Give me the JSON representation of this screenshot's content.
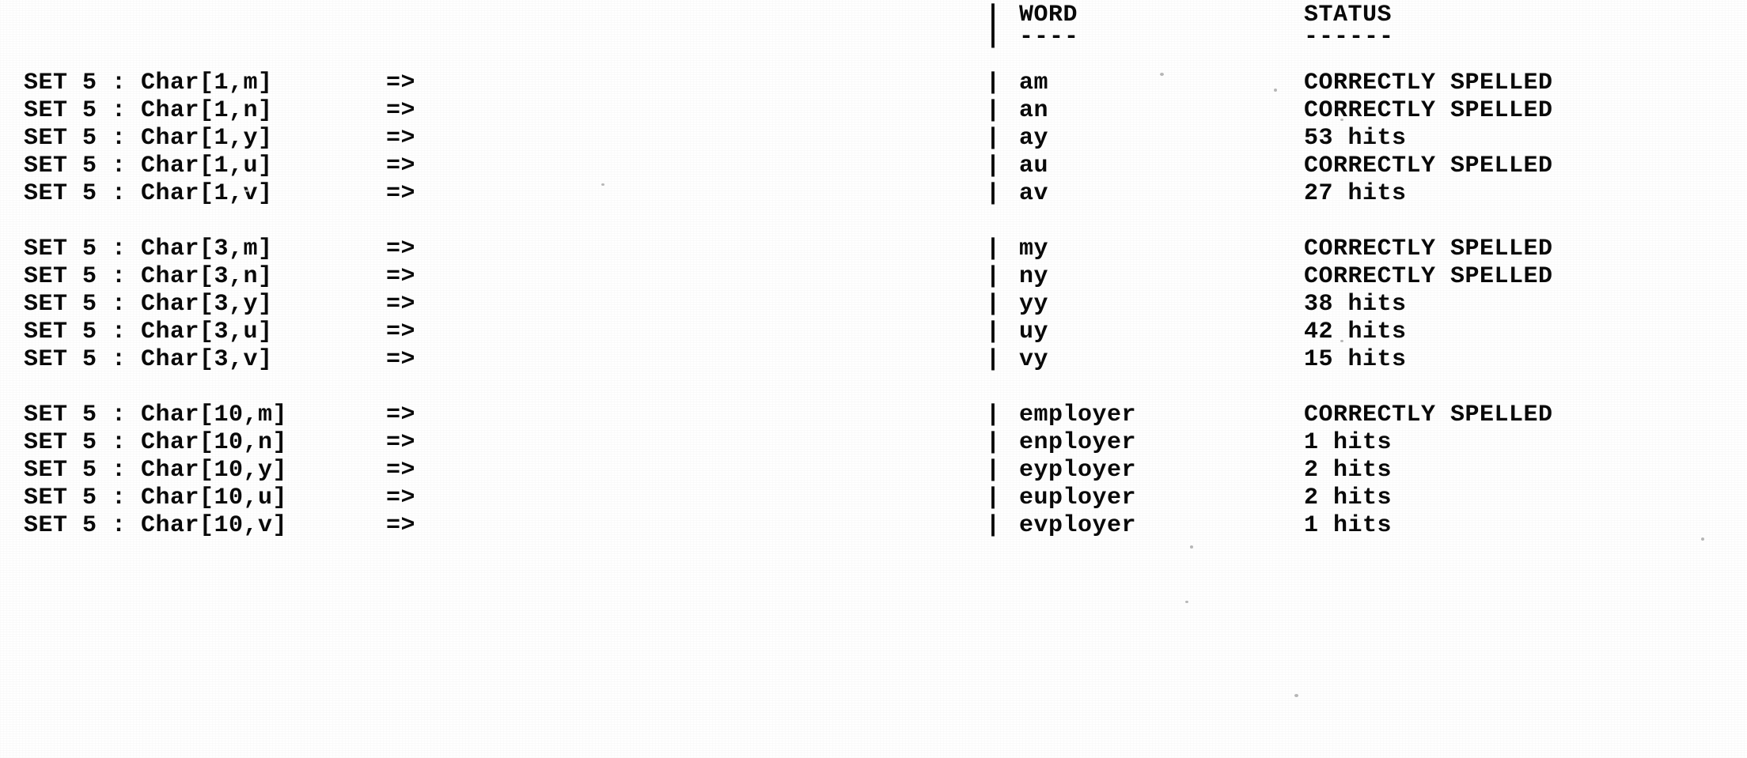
{
  "document": {
    "kind": "program-output-listing",
    "background_color": "#ffffff",
    "text_color": "#0a0a0a",
    "separator_char": "|",
    "arrow_symbol": "=>"
  },
  "table": {
    "headers": {
      "word_label": "WORD",
      "status_label": "STATUS",
      "word_underline": "----",
      "status_underline": "------"
    }
  },
  "blocks": [
    {
      "name": "position-1",
      "rows": [
        {
          "left": "SET 5 : Char[1,m]",
          "arrow": "=>",
          "pipe": "|",
          "word": "am",
          "status": "CORRECTLY SPELLED"
        },
        {
          "left": "SET 5 : Char[1,n]",
          "arrow": "=>",
          "pipe": "|",
          "word": "an",
          "status": "CORRECTLY SPELLED"
        },
        {
          "left": "SET 5 : Char[1,y]",
          "arrow": "=>",
          "pipe": "|",
          "word": "ay",
          "status": "53 hits"
        },
        {
          "left": "SET 5 : Char[1,u]",
          "arrow": "=>",
          "pipe": "|",
          "word": "au",
          "status": "CORRECTLY SPELLED"
        },
        {
          "left": "SET 5 : Char[1,v]",
          "arrow": "=>",
          "pipe": "|",
          "word": "av",
          "status": "27 hits"
        }
      ]
    },
    {
      "name": "position-3",
      "rows": [
        {
          "left": "SET 5 : Char[3,m]",
          "arrow": "=>",
          "pipe": "|",
          "word": "my",
          "status": "CORRECTLY SPELLED"
        },
        {
          "left": "SET 5 : Char[3,n]",
          "arrow": "=>",
          "pipe": "|",
          "word": "ny",
          "status": "CORRECTLY SPELLED"
        },
        {
          "left": "SET 5 : Char[3,y]",
          "arrow": "=>",
          "pipe": "|",
          "word": "yy",
          "status": "38 hits"
        },
        {
          "left": "SET 5 : Char[3,u]",
          "arrow": "=>",
          "pipe": "|",
          "word": "uy",
          "status": "42 hits"
        },
        {
          "left": "SET 5 : Char[3,v]",
          "arrow": "=>",
          "pipe": "|",
          "word": "vy",
          "status": "15 hits"
        }
      ]
    },
    {
      "name": "position-10",
      "rows": [
        {
          "left": "SET 5 : Char[10,m]",
          "arrow": "=>",
          "pipe": "|",
          "word": "employer",
          "status": "CORRECTLY SPELLED"
        },
        {
          "left": "SET 5 : Char[10,n]",
          "arrow": "=>",
          "pipe": "|",
          "word": "enployer",
          "status": "1 hits"
        },
        {
          "left": "SET 5 : Char[10,y]",
          "arrow": "=>",
          "pipe": "|",
          "word": "eyployer",
          "status": "2 hits"
        },
        {
          "left": "SET 5 : Char[10,u]",
          "arrow": "=>",
          "pipe": "|",
          "word": "euployer",
          "status": "2 hits"
        },
        {
          "left": "SET 5 : Char[10,v]",
          "arrow": "=>",
          "pipe": "|",
          "word": "evployer",
          "status": "1 hits"
        }
      ]
    }
  ]
}
